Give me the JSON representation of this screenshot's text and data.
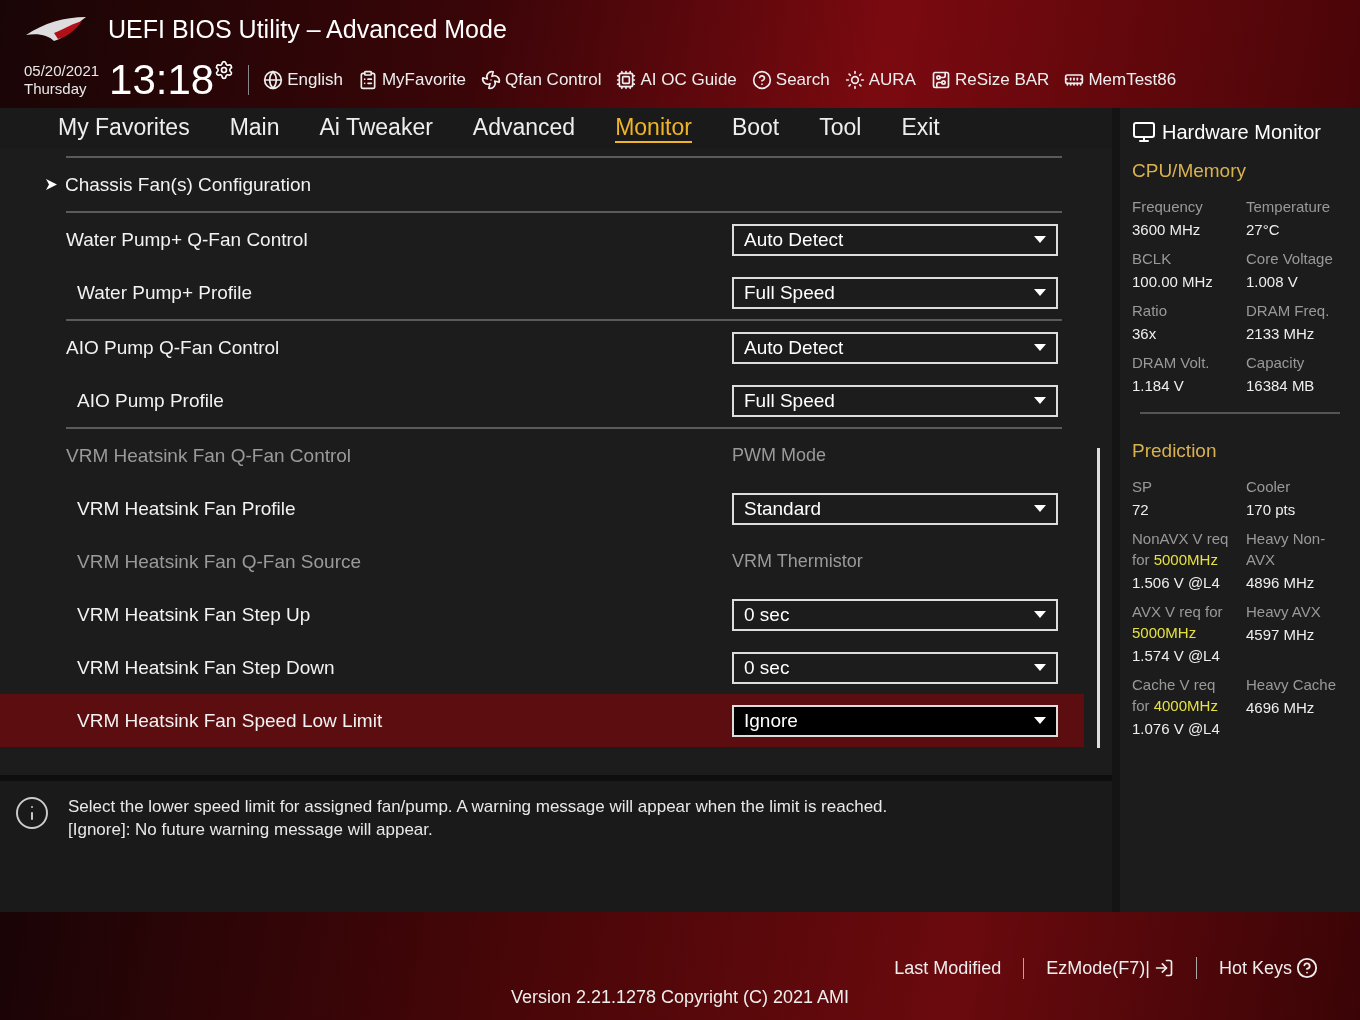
{
  "header": {
    "title": "UEFI BIOS Utility – Advanced Mode",
    "date": "05/20/2021",
    "day": "Thursday",
    "time": "13:18",
    "tools": [
      {
        "label": "English"
      },
      {
        "label": "MyFavorite"
      },
      {
        "label": "Qfan Control"
      },
      {
        "label": "AI OC Guide"
      },
      {
        "label": "Search"
      },
      {
        "label": "AURA"
      },
      {
        "label": "ReSize BAR"
      },
      {
        "label": "MemTest86"
      }
    ]
  },
  "tabs": [
    {
      "label": "My Favorites",
      "selected": false
    },
    {
      "label": "Main",
      "selected": false
    },
    {
      "label": "Ai Tweaker",
      "selected": false
    },
    {
      "label": "Advanced",
      "selected": false
    },
    {
      "label": "Monitor",
      "selected": true
    },
    {
      "label": "Boot",
      "selected": false
    },
    {
      "label": "Tool",
      "selected": false
    },
    {
      "label": "Exit",
      "selected": false
    }
  ],
  "items": [
    {
      "kind": "submenu",
      "label": "Chassis Fan(s) Configuration",
      "disabled": false,
      "selected": false
    },
    {
      "kind": "dropdown",
      "label": "Water Pump+ Q-Fan Control",
      "value": "Auto Detect",
      "disabled": false,
      "selected": false,
      "children": [
        {
          "kind": "dropdown",
          "label": "Water Pump+ Profile",
          "value": "Full Speed",
          "disabled": false,
          "selected": false
        }
      ]
    },
    {
      "kind": "dropdown",
      "label": "AIO Pump Q-Fan Control",
      "value": "Auto Detect",
      "disabled": false,
      "selected": false,
      "children": [
        {
          "kind": "dropdown",
          "label": "AIO Pump Profile",
          "value": "Full Speed",
          "disabled": false,
          "selected": false
        }
      ]
    },
    {
      "kind": "readonly",
      "label": "VRM Heatsink Fan Q-Fan Control",
      "value": "PWM Mode",
      "disabled": true,
      "selected": false,
      "children": [
        {
          "kind": "dropdown",
          "label": "VRM Heatsink Fan Profile",
          "value": "Standard",
          "disabled": false,
          "selected": false
        },
        {
          "kind": "readonly",
          "label": "VRM Heatsink Fan Q-Fan Source",
          "value": "VRM Thermistor",
          "disabled": true,
          "selected": false
        },
        {
          "kind": "dropdown",
          "label": "VRM Heatsink Fan Step Up",
          "value": "0 sec",
          "disabled": false,
          "selected": false
        },
        {
          "kind": "dropdown",
          "label": "VRM Heatsink Fan Step Down",
          "value": "0 sec",
          "disabled": false,
          "selected": false
        },
        {
          "kind": "dropdown",
          "label": "VRM Heatsink Fan Speed Low Limit",
          "value": "Ignore",
          "disabled": false,
          "selected": true
        }
      ]
    }
  ],
  "help": [
    "Select the lower speed limit for assigned fan/pump. A warning message will appear when the limit is reached.",
    "[Ignore]: No future warning message will appear."
  ],
  "monitor": {
    "title": "Hardware Monitor",
    "sections": [
      {
        "title": "CPU/Memory",
        "cells": [
          {
            "label": "Frequency",
            "value": "3600 MHz"
          },
          {
            "label": "Temperature",
            "value": "27°C"
          },
          {
            "label": "BCLK",
            "value": "100.00 MHz"
          },
          {
            "label": "Core Voltage",
            "value": "1.008 V"
          },
          {
            "label": "Ratio",
            "value": "36x"
          },
          {
            "label": "DRAM Freq.",
            "value": "2133 MHz"
          },
          {
            "label": "DRAM Volt.",
            "value": "1.184 V"
          },
          {
            "label": "Capacity",
            "value": "16384 MB"
          }
        ]
      },
      {
        "title": "Prediction",
        "cells": [
          {
            "label": "SP",
            "value": "72"
          },
          {
            "label": "Cooler",
            "value": "170 pts"
          },
          {
            "label": "NonAVX V req for **5000MHz**",
            "value": "1.506 V @L4"
          },
          {
            "label": "Heavy Non-AVX",
            "value": "4896 MHz"
          },
          {
            "label": "AVX V req for **5000MHz**",
            "value": "1.574 V @L4"
          },
          {
            "label": "Heavy AVX",
            "value": "4597 MHz"
          },
          {
            "label": "Cache V req for **4000MHz**",
            "value": "1.076 V @L4"
          },
          {
            "label": "Heavy Cache",
            "value": "4696 MHz"
          }
        ]
      }
    ]
  },
  "footer": {
    "links": [
      {
        "label": "Last Modified"
      },
      {
        "label": "EzMode(F7)|"
      },
      {
        "label": "Hot Keys"
      }
    ],
    "version": "Version 2.21.1278 Copyright (C) 2021 AMI"
  }
}
